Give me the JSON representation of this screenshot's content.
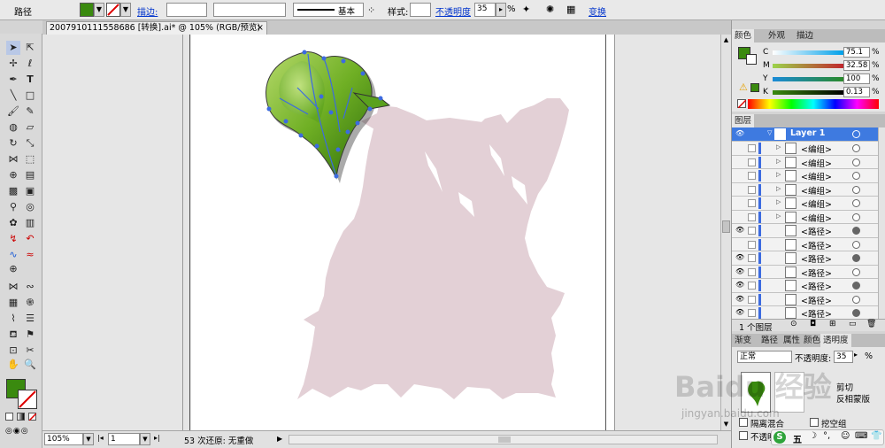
{
  "control_bar": {
    "selection_label": "路径",
    "stroke_label": "描边:",
    "stroke_profile": "基本",
    "style_label": "样式:",
    "opacity_label": "不透明度",
    "opacity_value": "35",
    "opacity_unit": "%",
    "transform_label": "变换"
  },
  "document": {
    "tab_title": "2007910111558686 [转换].ai* @ 105% (RGB/预览)",
    "close_symbol": "×"
  },
  "status_bar": {
    "zoom": "105%",
    "artboard_number": "1",
    "status_text": "53 次还原: 无重做"
  },
  "colors": {
    "fill": "#3a8a0f",
    "silhouette": "#e3d0d6",
    "accent": "#3c6be0"
  },
  "color_panel": {
    "tabs": [
      "颜色",
      "外观",
      "描边"
    ],
    "active_tab": "颜色",
    "channels": [
      {
        "label": "C",
        "value": "75.1"
      },
      {
        "label": "M",
        "value": "32.58"
      },
      {
        "label": "Y",
        "value": "100"
      },
      {
        "label": "K",
        "value": "0.13"
      }
    ],
    "unit": "%"
  },
  "layers_panel": {
    "title": "图层",
    "layer_name": "Layer 1",
    "items": [
      "<编组>",
      "<编组>",
      "<编组>",
      "<编组>",
      "<编组>",
      "<编组>",
      "<路径>",
      "<路径>",
      "<路径>",
      "<路径>",
      "<路径>",
      "<路径>",
      "<路径>"
    ],
    "footer_count": "1 个图层"
  },
  "transparency_panel": {
    "tabs": [
      "渐变",
      "路径",
      "属性",
      "颜色",
      "透明度"
    ],
    "active_tab": "透明度",
    "blend_mode": "正常",
    "opacity_label": "不透明度:",
    "opacity_value": "35",
    "opacity_unit": "%",
    "clip_label": "剪切",
    "invert_mask_label": "反相蒙版",
    "isolate_blend_label": "隔离混合",
    "knockout_group_label": "挖空组",
    "opacity_mask_label": "不透明"
  },
  "watermark": {
    "brand": "Baidu 经验",
    "url": "jingyan.baidu.com"
  },
  "ime_bar": {
    "mode": "五"
  }
}
